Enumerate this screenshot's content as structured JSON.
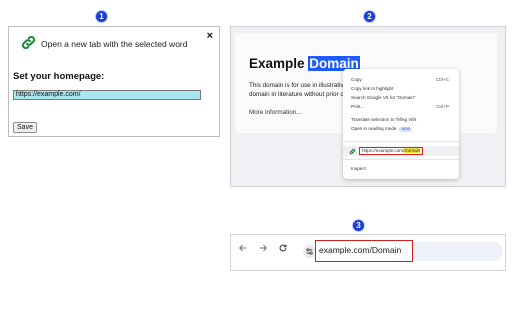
{
  "steps": [
    "1",
    "2",
    "3"
  ],
  "popup": {
    "title": "Open a new tab with the selected word",
    "close_label": "×",
    "heading": "Set your homepage:",
    "url_value": "https://example.com/",
    "save_label": "Save",
    "icon": "link-icon"
  },
  "webpage": {
    "title_plain": "Example",
    "title_selected": "Domain",
    "body_line1": "This domain is for use in illustrative",
    "body_line2": "domain in literature without prior c",
    "more_link": "More information..."
  },
  "context_menu": {
    "items": [
      {
        "label": "Copy",
        "shortcut": "Ctrl+C"
      },
      {
        "label": "Copy link to highlight",
        "shortcut": ""
      },
      {
        "label": "Search Google V6 for \"Domain\"",
        "shortcut": ""
      },
      {
        "label": "Print...",
        "shortcut": "Ctrl+P"
      },
      {
        "label": "Translate selection to Tiếng Việt",
        "shortcut": ""
      },
      {
        "label": "Open in reading mode",
        "shortcut": "",
        "badge": "NEW"
      }
    ],
    "extension_item": {
      "url_prefix": "https://example.com/",
      "url_highlight": "Domain"
    },
    "inspect_label": "Inspect"
  },
  "address_bar": {
    "back_icon": "arrow-left-icon",
    "forward_icon": "arrow-right-icon",
    "reload_icon": "reload-icon",
    "url": "example.com/Domain"
  },
  "colors": {
    "step_badge": "#1a3fd6",
    "selection": "#1e5cff",
    "input_bg": "#a9e6ef",
    "highlight_box": "#e32020",
    "highlight_text": "#f5e23a",
    "link_icon": "#1e8e3e"
  }
}
